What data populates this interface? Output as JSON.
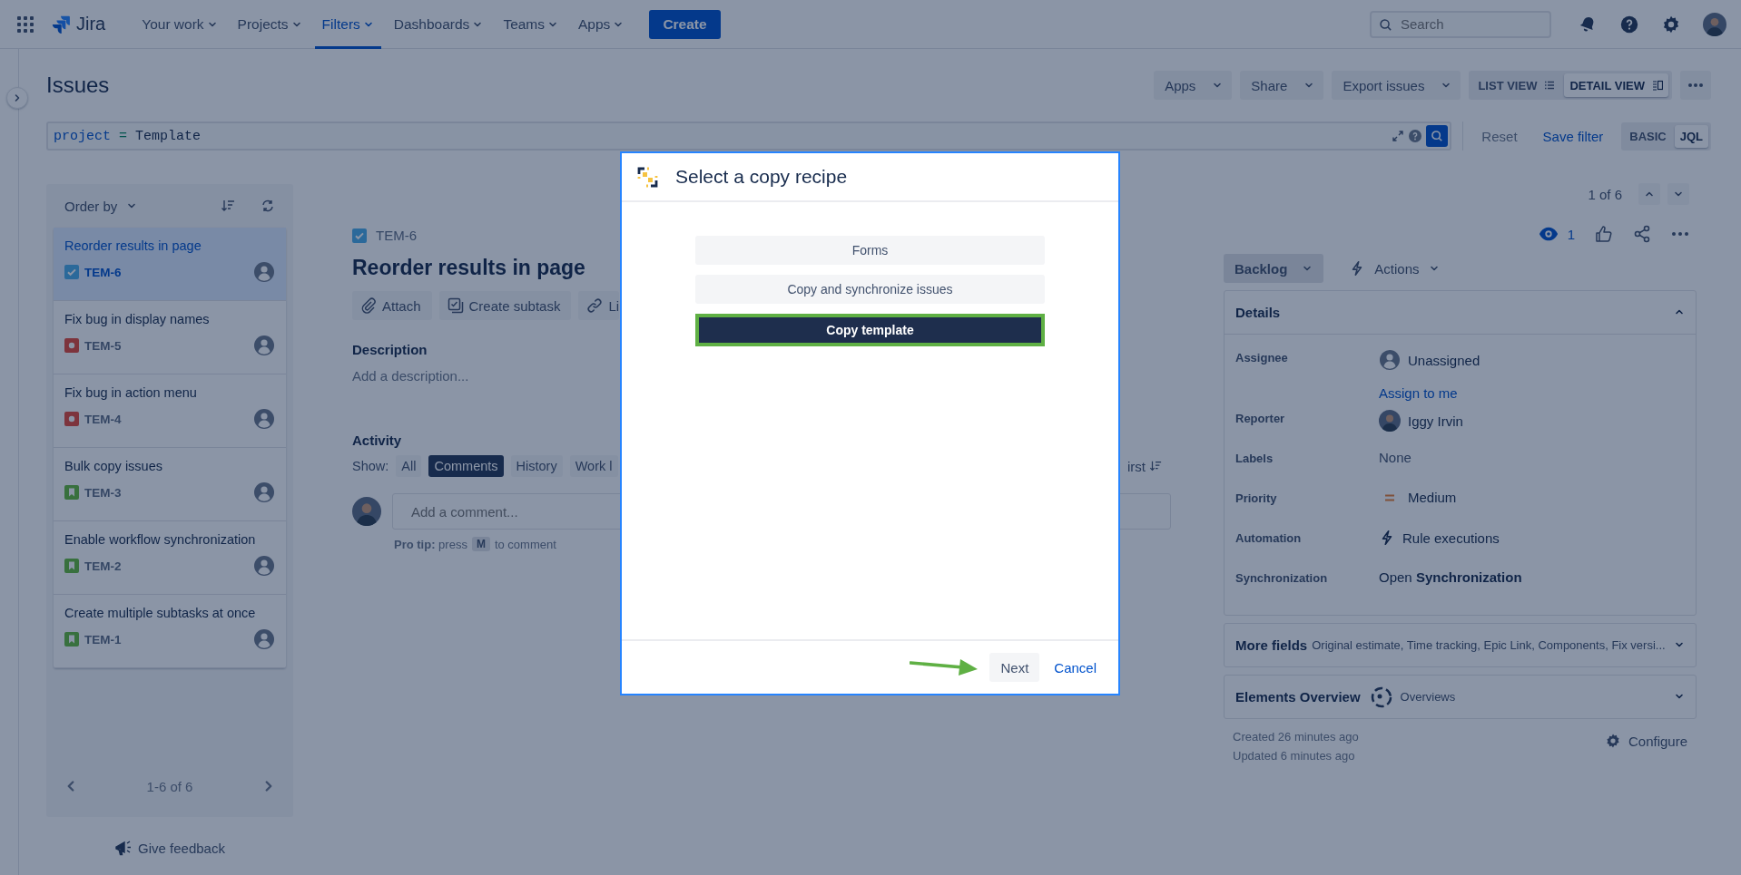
{
  "top_nav": {
    "logo": "Jira",
    "items": [
      {
        "label": "Your work",
        "selected": false
      },
      {
        "label": "Projects",
        "selected": false
      },
      {
        "label": "Filters",
        "selected": true
      },
      {
        "label": "Dashboards",
        "selected": false
      },
      {
        "label": "Teams",
        "selected": false
      },
      {
        "label": "Apps",
        "selected": false
      }
    ],
    "create": "Create",
    "search": {
      "placeholder": "Search"
    }
  },
  "page": {
    "title": "Issues",
    "actions": [
      "Apps",
      "Share",
      "Export issues"
    ],
    "views": [
      {
        "label": "LIST VIEW",
        "selected": false
      },
      {
        "label": "DETAIL VIEW",
        "selected": true
      }
    ]
  },
  "jql": {
    "keyword": "project",
    "operator": "=",
    "value": "Template",
    "reset": "Reset",
    "save": "Save filter",
    "modes": [
      {
        "label": "BASIC",
        "selected": false
      },
      {
        "label": "JQL",
        "selected": true
      }
    ]
  },
  "issue_list": {
    "order_by": "Order by",
    "items": [
      {
        "title": "Reorder results in page",
        "key": "TEM-6",
        "kind": "task",
        "selected": true
      },
      {
        "title": "Fix bug in display names",
        "key": "TEM-5",
        "kind": "bug",
        "selected": false
      },
      {
        "title": "Fix bug in action menu",
        "key": "TEM-4",
        "kind": "bug",
        "selected": false
      },
      {
        "title": "Bulk copy issues",
        "key": "TEM-3",
        "kind": "story",
        "selected": false
      },
      {
        "title": "Enable workflow synchronization",
        "key": "TEM-2",
        "kind": "story",
        "selected": false
      },
      {
        "title": "Create multiple subtasks at once",
        "key": "TEM-1",
        "kind": "story",
        "selected": false
      }
    ],
    "pagination": "1-6 of 6"
  },
  "feedback": "Give feedback",
  "issue": {
    "key": "TEM-6",
    "title": "Reorder results in page",
    "actions": [
      {
        "label": "Attach",
        "kind": "attach"
      },
      {
        "label": "Create subtask",
        "kind": "subtask"
      },
      {
        "label": "Li",
        "kind": "link"
      }
    ],
    "description_label": "Description",
    "description_placeholder": "Add a description...",
    "activity": "Activity",
    "show_label": "Show:",
    "filters": [
      {
        "label": "All",
        "selected": false
      },
      {
        "label": "Comments",
        "selected": true
      },
      {
        "label": "History",
        "selected": false
      },
      {
        "label": "Work l",
        "selected": false
      }
    ],
    "sort": "irst",
    "comment_placeholder": "Add a comment...",
    "pro_tip": "**Pro tip:** press",
    "pro_tip_key": "M",
    "pro_tip_end": "to comment"
  },
  "sidebar": {
    "counter": "1 of 6",
    "watchers": "1",
    "status": "Backlog",
    "actions": "Actions",
    "details": {
      "title": "Details",
      "expanded": true,
      "fields": [
        {
          "label": "Assignee",
          "value": "Unassigned",
          "kind": "unassigned",
          "link": "Assign to me"
        },
        {
          "label": "Reporter",
          "value": "Iggy Irvin",
          "kind": "user"
        },
        {
          "label": "Labels",
          "value": "None",
          "kind": "empty"
        },
        {
          "label": "Priority",
          "value": "Medium",
          "kind": "priority"
        },
        {
          "label": "Automation",
          "value": "Rule executions",
          "kind": "automation"
        },
        {
          "label": "Synchronization",
          "value": "Open **Synchronization**",
          "kind": "rich"
        }
      ]
    },
    "more_fields": {
      "title": "More fields",
      "summary": "Original estimate, Time tracking, Epic Link, Components, Fix versi...",
      "expanded": false
    },
    "elements": {
      "title": "Elements Overview",
      "subtitle": "Overviews",
      "expanded": false
    },
    "created": "Created 26 minutes ago",
    "updated": "Updated 6 minutes ago",
    "configure": "Configure"
  },
  "dialog": {
    "title": "Select a copy recipe",
    "recipes": [
      {
        "label": "Forms",
        "selected": false
      },
      {
        "label": "Copy and synchronize issues",
        "selected": false
      },
      {
        "label": "Copy template",
        "selected": true
      }
    ],
    "next": "Next",
    "cancel": "Cancel"
  }
}
